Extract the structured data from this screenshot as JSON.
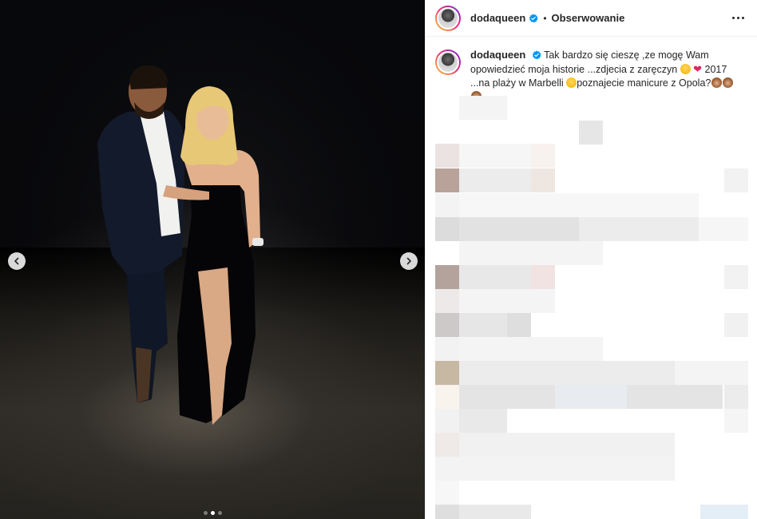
{
  "post": {
    "username": "dodaqueen",
    "verified": true,
    "separator": "•",
    "follow_label": "Obserwowanie",
    "caption": {
      "part1": "Tak bardzo się cieszę ,ze mogę Wam opowiedzieć moja historie ...zdjecia z zaręczyn",
      "part2": "2017 ...na plaży w Marbelli",
      "part3": "poznajecie manicure z Opola?"
    },
    "carousel": {
      "current_index": 2,
      "total": 3
    }
  },
  "icons": {
    "verified": "verified-badge-icon",
    "more": "more-options-icon",
    "prev": "chevron-left-icon",
    "next": "chevron-right-icon"
  },
  "colors": {
    "verified_blue": "#0095f6",
    "ring_start": "#f9ce34",
    "ring_mid": "#ee2a7b",
    "ring_end": "#6228d7"
  }
}
